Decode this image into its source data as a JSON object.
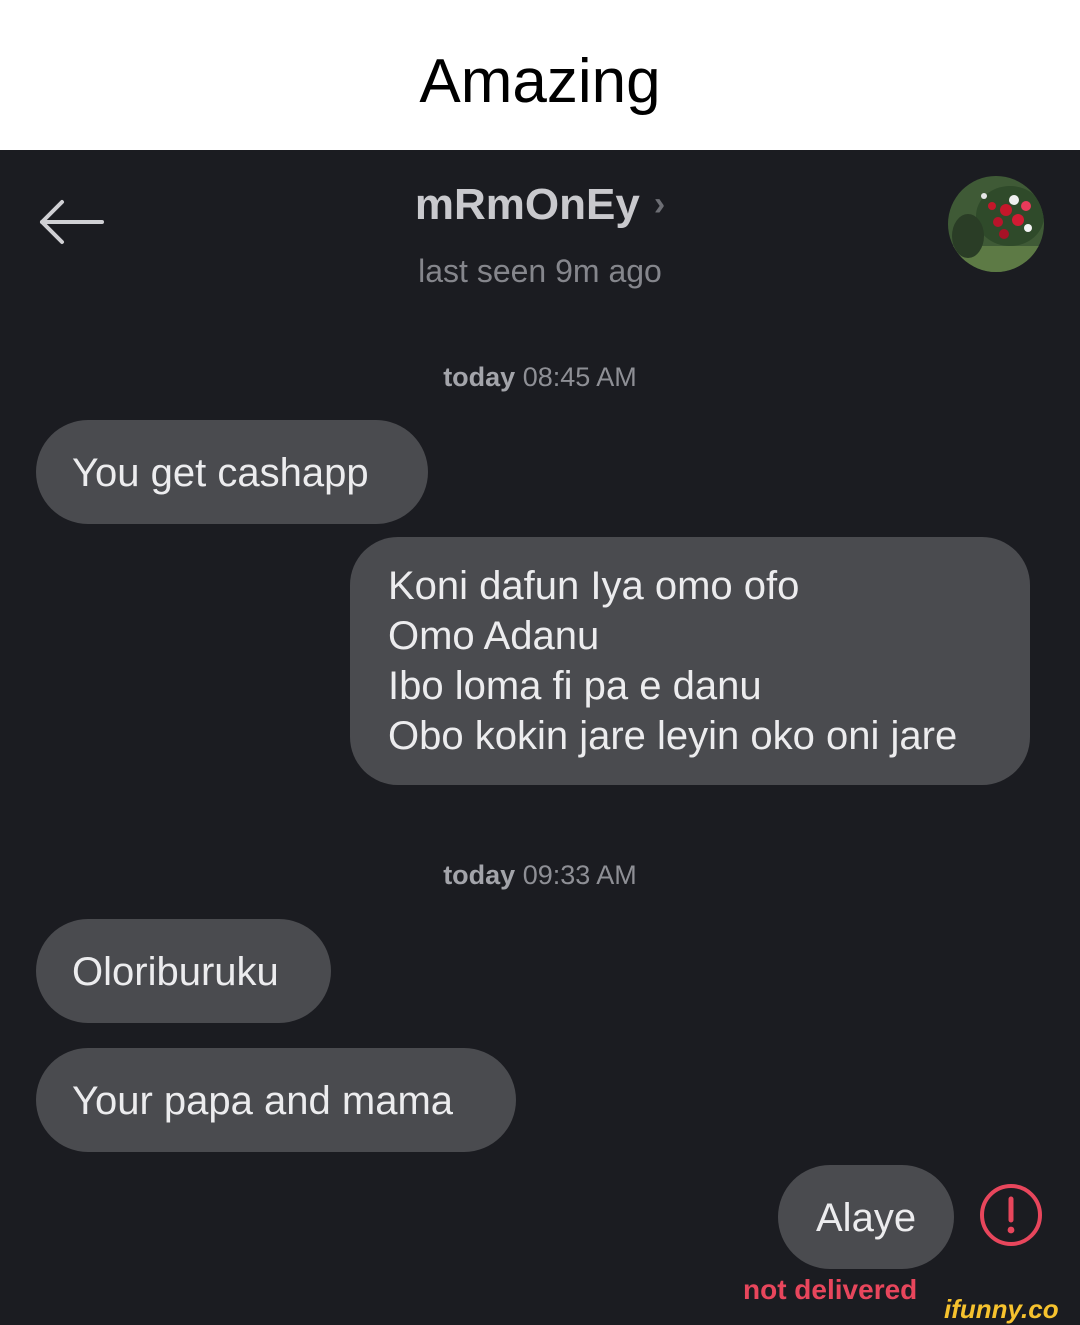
{
  "meme_caption": "Amazing",
  "header": {
    "contact_name": "mRmOnEy",
    "chevron": "›",
    "status": "last seen 9m ago"
  },
  "timestamps": [
    {
      "day": "today",
      "time": "08:45 AM"
    },
    {
      "day": "today",
      "time": "09:33 AM"
    }
  ],
  "messages": [
    {
      "direction": "incoming",
      "lines": [
        "You get cashapp"
      ]
    },
    {
      "direction": "outgoing",
      "lines": [
        "Koni dafun Iya omo ofo",
        "Omo Adanu",
        "Ibo loma fi pa e danu",
        "Obo kokin jare leyin oko oni jare"
      ]
    },
    {
      "direction": "incoming",
      "lines": [
        "Oloriburuku"
      ]
    },
    {
      "direction": "incoming",
      "lines": [
        "Your papa and mama"
      ]
    },
    {
      "direction": "outgoing",
      "lines": [
        "Alaye"
      ],
      "status": "not delivered"
    }
  ],
  "watermark": "ifunny.co",
  "icons": {
    "back": "arrow-left-icon",
    "error": "exclamation-circle-icon",
    "avatar": "flower-avatar"
  },
  "colors": {
    "background": "#1b1c21",
    "bubble": "#4a4b4f",
    "error": "#e8465c",
    "watermark": "#f6c22e"
  }
}
